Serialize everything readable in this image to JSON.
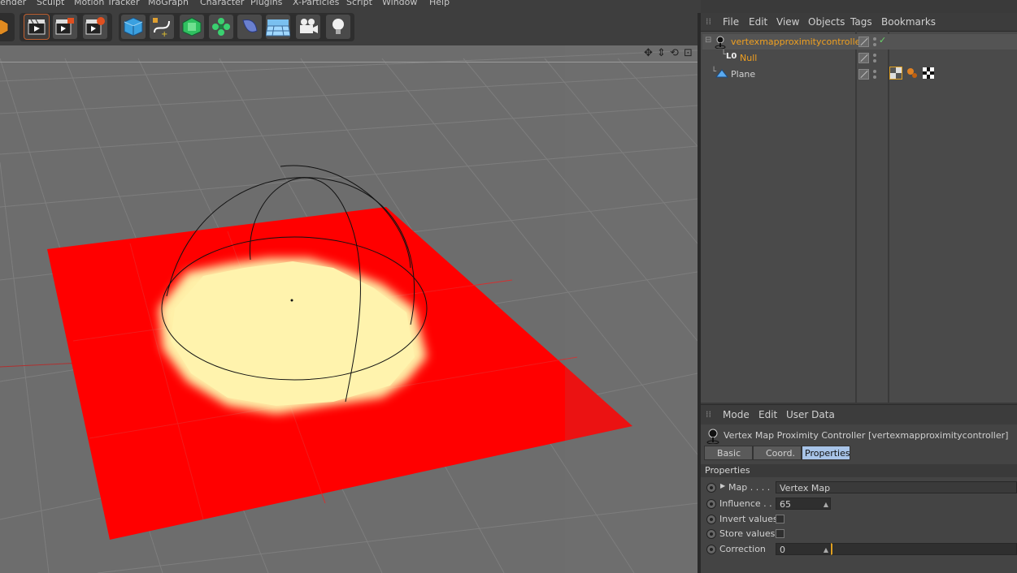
{
  "menu": [
    "Render",
    "Sculpt",
    "Motion Tracker",
    "MoGraph",
    "Character",
    "Plugins",
    "X-Particles",
    "Script",
    "Window",
    "Help"
  ],
  "toolbar": {
    "icons": [
      "cube-icon",
      "render-view-icon",
      "render-pv-icon",
      "render-settings-icon",
      "primitive-cube-icon",
      "spline-pen-icon",
      "subdivision-icon",
      "cloner-icon",
      "deformer-icon",
      "floor-icon",
      "camera-icon",
      "light-icon"
    ]
  },
  "object_manager": {
    "menu": [
      "File",
      "Edit",
      "View",
      "Objects",
      "Tags",
      "Bookmarks"
    ],
    "objects": [
      {
        "name": "vertexmapproximitycontroller",
        "color": "#f0a020",
        "selected": true,
        "icon": "proximity-controller-icon",
        "check": "✓"
      },
      {
        "name": "Null",
        "color": "#f0a020",
        "selected": false,
        "icon": "null-object-icon",
        "prefix": "L0"
      },
      {
        "name": "Plane",
        "color": "#d0d0d0",
        "selected": false,
        "icon": "plane-object-icon"
      }
    ],
    "tag_icons": [
      "vertex-map-tag-icon",
      "material-tag-icon",
      "texture-tag-icon"
    ]
  },
  "attribute_manager": {
    "menu": [
      "Mode",
      "Edit",
      "User Data"
    ],
    "title": "Vertex Map Proximity Controller [vertexmapproximitycontroller]",
    "tabs": [
      "Basic",
      "Coord.",
      "Properties"
    ],
    "active_tab": "Properties",
    "section": "Properties",
    "props": [
      {
        "label": "Map . . . .",
        "value": "Vertex Map",
        "type": "link"
      },
      {
        "label": "Influence . .",
        "value": "65",
        "type": "number"
      },
      {
        "label": "Invert values",
        "type": "checkbox",
        "checked": false
      },
      {
        "label": "Store values",
        "type": "checkbox",
        "checked": false
      },
      {
        "label": "Correction",
        "value": "0",
        "type": "number"
      }
    ]
  },
  "colors": {
    "accent": "#f0a020",
    "selection": "#a8c4e8",
    "plane_red": "#ff0000",
    "influence_yellow": "#fff0a8"
  }
}
